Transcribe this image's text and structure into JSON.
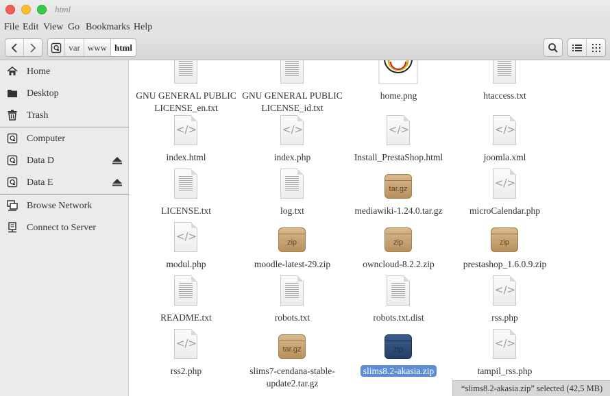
{
  "window": {
    "title": "html"
  },
  "menu": [
    "File",
    "Edit",
    "View",
    "Go",
    "Bookmarks",
    "Help"
  ],
  "breadcrumb": [
    "var",
    "www",
    "html"
  ],
  "sidebar": {
    "items": [
      {
        "label": "Home",
        "icon": "home-icon"
      },
      {
        "label": "Desktop",
        "icon": "folder-icon"
      },
      {
        "label": "Trash",
        "icon": "trash-icon"
      },
      {
        "label": "Computer",
        "icon": "drive-icon"
      },
      {
        "label": "Data D",
        "icon": "drive-icon"
      },
      {
        "label": "Data E",
        "icon": "drive-icon"
      },
      {
        "label": "Browse Network",
        "icon": "network-icon"
      },
      {
        "label": "Connect to Server",
        "icon": "server-icon"
      }
    ]
  },
  "files": [
    {
      "line1": "GNU GENERAL PUBLIC",
      "line2": "LICENSE_en.txt",
      "type": "text"
    },
    {
      "line1": "GNU GENERAL PUBLIC",
      "line2": "LICENSE_id.txt",
      "type": "text"
    },
    {
      "line1": "home.png",
      "type": "image"
    },
    {
      "line1": "htaccess.txt",
      "type": "text"
    },
    {
      "line1": "index.html",
      "type": "code"
    },
    {
      "line1": "index.php",
      "type": "code"
    },
    {
      "line1": "Install_PrestaShop.html",
      "type": "code"
    },
    {
      "line1": "joomla.xml",
      "type": "code"
    },
    {
      "line1": "LICENSE.txt",
      "type": "text"
    },
    {
      "line1": "log.txt",
      "type": "text"
    },
    {
      "line1": "mediawiki-1.24.0.tar.gz",
      "type": "archive",
      "badge": "tar.gz"
    },
    {
      "line1": "microCalendar.php",
      "type": "code"
    },
    {
      "line1": "modul.php",
      "type": "code"
    },
    {
      "line1": "moodle-latest-29.zip",
      "type": "archive",
      "badge": "zip"
    },
    {
      "line1": "owncloud-8.2.2.zip",
      "type": "archive",
      "badge": "zip"
    },
    {
      "line1": "prestashop_1.6.0.9.zip",
      "type": "archive",
      "badge": "zip"
    },
    {
      "line1": "README.txt",
      "type": "text"
    },
    {
      "line1": "robots.txt",
      "type": "text"
    },
    {
      "line1": "robots.txt.dist",
      "type": "text"
    },
    {
      "line1": "rss.php",
      "type": "code"
    },
    {
      "line1": "rss2.php",
      "type": "code"
    },
    {
      "line1": "slims7-cendana-stable-",
      "line2": "update2.tar.gz",
      "type": "archive",
      "badge": "tar.gz"
    },
    {
      "line1": "slims8.2-akasia.zip",
      "type": "archive-selected",
      "badge": "zip",
      "selected": true
    },
    {
      "line1": "tampil_rss.php",
      "type": "code"
    }
  ],
  "status": {
    "text": "“slims8.2-akasia.zip” selected  (42,5 MB)"
  },
  "colors": {
    "selection": "#5d8ed5",
    "sidebar_bg": "#ebebeb"
  }
}
